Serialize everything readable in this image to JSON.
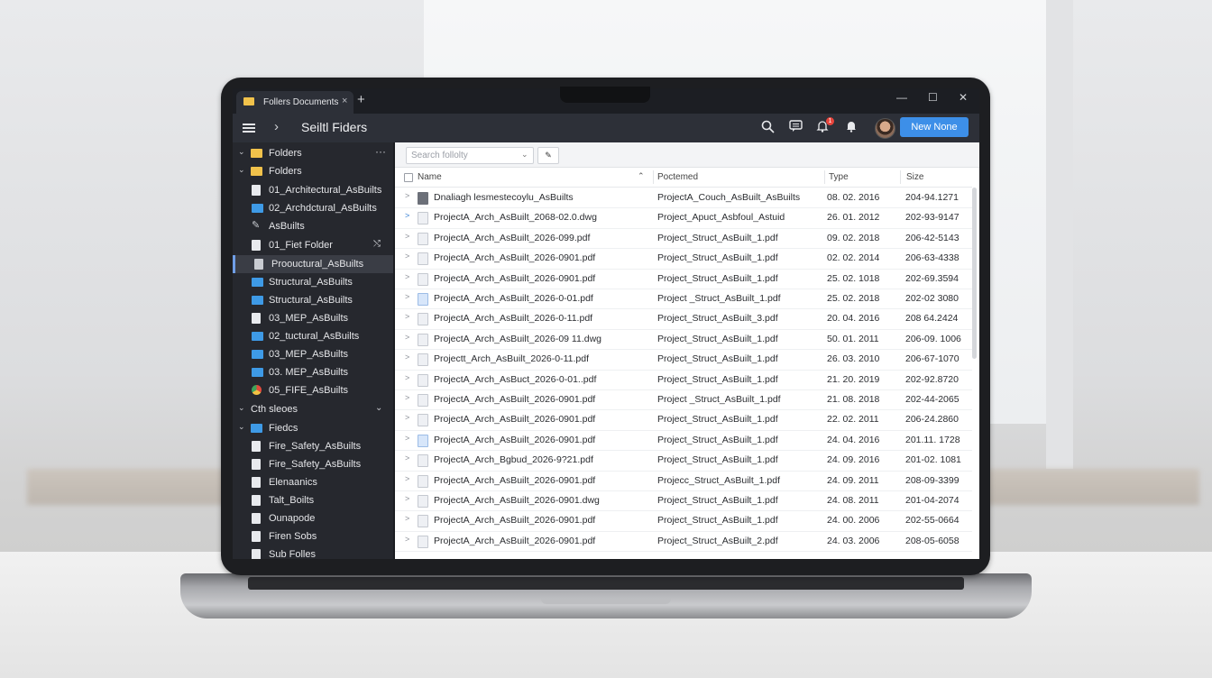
{
  "window": {
    "tab_title": "Follers Documents",
    "tab_close": "×",
    "new_tab": "+",
    "controls": [
      "—",
      "☐",
      "✕"
    ]
  },
  "toolbar": {
    "title": "Seiltl Fiders",
    "notification_count": "1",
    "new_button": "New None",
    "icons": [
      "menu-icon",
      "chevron-right-icon",
      "search-icon",
      "chat-icon",
      "bell-alert-icon",
      "bell-icon",
      "avatar"
    ]
  },
  "sidebar": {
    "items": [
      {
        "label": "Folders",
        "icon": "folder-yellow",
        "expander": "open",
        "extra": "more"
      },
      {
        "label": "Folders",
        "icon": "folder-yellow",
        "expander": "open"
      },
      {
        "label": "01_Architectural_AsBuilts",
        "icon": "file"
      },
      {
        "label": "02_Archdctural_AsBuilts",
        "icon": "folder-blue"
      },
      {
        "label": "AsBuilts",
        "icon": "brush"
      },
      {
        "label": "01_Fiet Folder",
        "icon": "file",
        "extra": "share"
      },
      {
        "label": "Proouctural_AsBuilts",
        "icon": "filedim",
        "selected": true
      },
      {
        "label": "Structural_AsBuilts",
        "icon": "folder-blue"
      },
      {
        "label": "Structural_AsBuilts",
        "icon": "folder-blue"
      },
      {
        "label": "03_MEP_AsBuilts",
        "icon": "file"
      },
      {
        "label": "02_tuctural_AsBuilts",
        "icon": "folder-blue"
      },
      {
        "label": "03_MEP_AsBuilts",
        "icon": "folder-blue"
      },
      {
        "label": "03. MEP_AsBuilts",
        "icon": "folder-blue"
      },
      {
        "label": "05_FIFE_AsBuilts",
        "icon": "chrome"
      },
      {
        "label": "Cth sleoes",
        "icon": "none",
        "expander": "open",
        "extra": "chevron"
      },
      {
        "label": "Fiedcs",
        "icon": "folder-blue",
        "expander": "open"
      },
      {
        "label": "Fire_Safety_AsBuilts",
        "icon": "file"
      },
      {
        "label": "Fire_Safety_AsBuilts",
        "icon": "file"
      },
      {
        "label": "Elenaanics",
        "icon": "file"
      },
      {
        "label": "Talt_Boilts",
        "icon": "file"
      },
      {
        "label": "Ounapode",
        "icon": "file"
      },
      {
        "label": "Firen Sobs",
        "icon": "file"
      },
      {
        "label": "Sub Folles",
        "icon": "file"
      }
    ]
  },
  "search": {
    "placeholder": "Search follolty"
  },
  "table": {
    "headers": {
      "name": "Name",
      "modified": "Poctemed",
      "type": "Type",
      "size": "Size"
    },
    "rows": [
      {
        "name": "Dnaliagh lesmestecoylu_AsBuilts",
        "modified": "ProjectA_Couch_AsBuilt_AsBuilts",
        "type": "08. 02. 2016",
        "size": "204-94.1271",
        "icon": "dark",
        "exp": ">"
      },
      {
        "name": "ProjectA_Arch_AsBuilt_2068-02.0.dwg",
        "modified": "Project_Apuct_Asbfoul_Astuid",
        "type": "26. 01. 2012",
        "size": "202-93-9147",
        "icon": "plain",
        "exp": ">",
        "exp_blue": true
      },
      {
        "name": "ProjectA_Arch_AsBuilt_2026-099.pdf",
        "modified": "Project_Struct_AsBuilt_1.pdf",
        "type": "09. 02. 2018",
        "size": "206-42-5143",
        "icon": "plain",
        "exp": ">"
      },
      {
        "name": "ProjectA_Arch_AsBuilt_2026-0901.pdf",
        "modified": "Project_Struct_AsBuilt_1.pdf",
        "type": "02. 02. 2014",
        "size": "206-63-4338",
        "icon": "plain",
        "exp": ">"
      },
      {
        "name": "ProjectA_Arch_AsBuilt_2026-0901.pdf",
        "modified": "Project_Struct_AsBuilt_1.pdf",
        "type": "25. 02. 1018",
        "size": "202-69.3594",
        "icon": "plain",
        "exp": ">"
      },
      {
        "name": "ProjectA_Arch_AsBuilt_2026-0-01.pdf",
        "modified": "Project _Struct_AsBuilt_1.pdf",
        "type": "25. 02. 2018",
        "size": "202-02 3080",
        "icon": "blue",
        "exp": ">"
      },
      {
        "name": "ProjectA_Arch_AsBuilt_2026-0-11.pdf",
        "modified": "Project_Struct_AsBuilt_3.pdf",
        "type": "20. 04. 2016",
        "size": "208 64.2424",
        "icon": "plain",
        "exp": ">"
      },
      {
        "name": "ProjectA_Arch_AsBuilt_2026-09 11.dwg",
        "modified": "Project_Struct_AsBuilt_1.pdf",
        "type": "50. 01. 2011",
        "size": "206-09. 1006",
        "icon": "plain",
        "exp": ">"
      },
      {
        "name": "Projectt_Arch_AsBuilt_2026-0-11.pdf",
        "modified": "Project_Struct_AsBuilt_1.pdf",
        "type": "26. 03. 2010",
        "size": "206-67-1070",
        "icon": "plain",
        "exp": ">"
      },
      {
        "name": "ProjectA_Arch_AsBuct_2026-0-01..pdf",
        "modified": "Project_Struct_AsBuilt_1.pdf",
        "type": "21. 20. 2019",
        "size": "202-92.8720",
        "icon": "plain",
        "exp": ">"
      },
      {
        "name": "ProjectA_Arch_AsBuilt_2026-0901.pdf",
        "modified": "Project _Struct_AsBuilt_1.pdf",
        "type": "21. 08. 2018",
        "size": "202-44-2065",
        "icon": "plain",
        "exp": ">"
      },
      {
        "name": "ProjectA_Arch_AsBuilt_2026-0901.pdf",
        "modified": "Project_Struct_AsBuilt_1.pdf",
        "type": "22. 02. 2011",
        "size": "206-24.2860",
        "icon": "plain",
        "exp": ">"
      },
      {
        "name": "ProjectA_Arch_AsBuilt_2026-0901.pdf",
        "modified": "Project_Struct_AsBuilt_1.pdf",
        "type": "24. 04. 2016",
        "size": "201.11. 1728",
        "icon": "blue",
        "exp": ">"
      },
      {
        "name": "ProjectA_Arch_Bgbud_2026-9?21.pdf",
        "modified": "Project_Struct_AsBuilt_1.pdf",
        "type": "24. 09. 2016",
        "size": "201-02. 1081",
        "icon": "plain",
        "exp": ">"
      },
      {
        "name": "ProjectA_Arch_AsBuilt_2026-0901.pdf",
        "modified": "Projecc_Struct_AsBuilt_1.pdf",
        "type": "24. 09. 2011",
        "size": "208-09-3399",
        "icon": "plain",
        "exp": ">"
      },
      {
        "name": "ProjectA_Arch_AsBuilt_2026-0901.dwg",
        "modified": "Project_Struct_AsBuilt_1.pdf",
        "type": "24. 08. 2011",
        "size": "201-04-2074",
        "icon": "plain",
        "exp": ">"
      },
      {
        "name": "ProjectA_Arch_AsBuilt_2026-0901.pdf",
        "modified": "Project_Struct_AsBuilt_1.pdf",
        "type": "24. 00. 2006",
        "size": "202-55-0664",
        "icon": "plain",
        "exp": ">"
      },
      {
        "name": "ProjectA_Arch_AsBuilt_2026-0901.pdf",
        "modified": "Project_Struct_AsBuilt_2.pdf",
        "type": "24. 03. 2006",
        "size": "208-05-6058",
        "icon": "plain",
        "exp": ">"
      }
    ]
  }
}
